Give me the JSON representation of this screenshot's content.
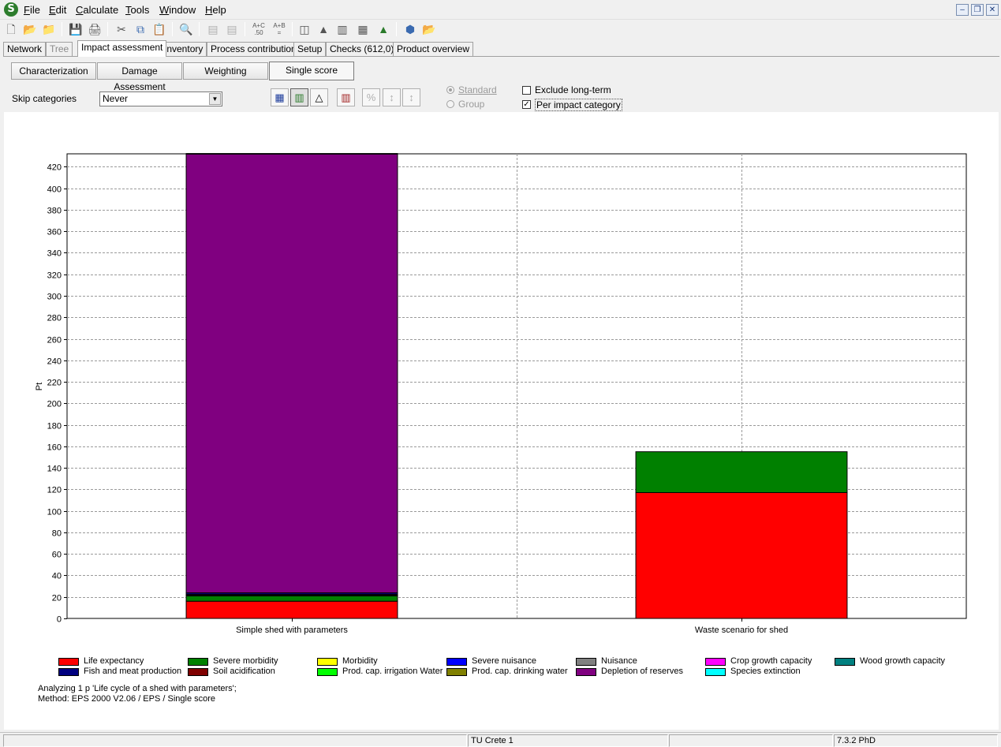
{
  "menu": {
    "items": [
      {
        "u": "F",
        "rest": "ile"
      },
      {
        "u": "E",
        "rest": "dit"
      },
      {
        "u": "C",
        "rest": "alculate"
      },
      {
        "u": "T",
        "rest": "ools"
      },
      {
        "u": "W",
        "rest": "indow"
      },
      {
        "u": "H",
        "rest": "elp"
      }
    ],
    "logo": "S"
  },
  "toolbar": {
    "calc_label_a": "A+C\n.50",
    "calc_label_b": "A+B\n="
  },
  "main_tabs": [
    "Network",
    "Tree",
    "Impact assessment",
    "Inventory",
    "Process contribution",
    "Setup",
    "Checks (612,0)",
    "Product overview"
  ],
  "sub_tabs": [
    "Characterization",
    "Damage Assessment",
    "Weighting",
    "Single score"
  ],
  "options": {
    "skip_label": "Skip categories",
    "skip_value": "Never",
    "standard": "Standard",
    "group": "Group",
    "exclude_long_term": "Exclude long-term",
    "per_impact_category": "Per impact category",
    "exclude_checked": false,
    "per_impact_checked": true
  },
  "chart_data": {
    "type": "bar",
    "stacked": true,
    "ylabel": "Pt",
    "ylim": [
      0,
      432
    ],
    "yticks": [
      0,
      20,
      40,
      60,
      80,
      100,
      120,
      140,
      160,
      180,
      200,
      220,
      240,
      260,
      280,
      300,
      320,
      340,
      360,
      380,
      400,
      420
    ],
    "categories": [
      "Simple shed with parameters",
      "Waste scenario for shed"
    ],
    "grid": true,
    "legend_position": "bottom",
    "series": [
      {
        "name": "Life expectancy",
        "color": "#ff0000",
        "values": [
          16,
          117
        ]
      },
      {
        "name": "Severe morbidity",
        "color": "#008000",
        "values": [
          5,
          38
        ]
      },
      {
        "name": "Morbidity",
        "color": "#ffff00",
        "values": [
          0.3,
          0
        ]
      },
      {
        "name": "Severe nuisance",
        "color": "#0000ff",
        "values": [
          0,
          0
        ]
      },
      {
        "name": "Nuisance",
        "color": "#808080",
        "values": [
          0.5,
          0
        ]
      },
      {
        "name": "Crop growth capacity",
        "color": "#ff00ff",
        "values": [
          0,
          0
        ]
      },
      {
        "name": "Wood growth capacity",
        "color": "#008080",
        "values": [
          0.5,
          0
        ]
      },
      {
        "name": "Fish and meat production",
        "color": "#000080",
        "values": [
          1.5,
          0
        ]
      },
      {
        "name": "Soil acidification",
        "color": "#800000",
        "values": [
          0,
          0
        ]
      },
      {
        "name": "Prod. cap. irrigation Water",
        "color": "#00ff00",
        "values": [
          0,
          0
        ]
      },
      {
        "name": "Prod. cap. drinking water",
        "color": "#808000",
        "values": [
          0,
          0
        ]
      },
      {
        "name": "Depletion of reserves",
        "color": "#800080",
        "values": [
          408,
          0
        ]
      },
      {
        "name": "Species extinction",
        "color": "#00ffff",
        "values": [
          0.5,
          0
        ]
      }
    ]
  },
  "analysis": {
    "line1": "Analyzing 1 p 'Life cycle of a shed with parameters';",
    "line2": "Method: EPS 2000 V2.06 / EPS / Single score"
  },
  "status": {
    "project": "TU Crete 1",
    "version": "7.3.2 PhD"
  }
}
